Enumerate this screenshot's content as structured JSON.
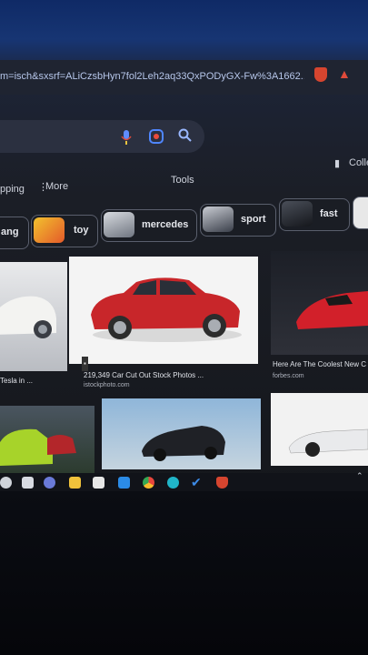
{
  "browser": {
    "url": "m=isch&sxsrf=ALiCzsbHyn7fol2Leh2aq33QxPODyGX-Fw%3A1662...",
    "collections_label": "Colle"
  },
  "tabs": {
    "shopping_label": "pping",
    "more_label": "More",
    "tools_label": "Tools"
  },
  "chips": [
    {
      "label": "ang"
    },
    {
      "label": "toy"
    },
    {
      "label": "mercedes"
    },
    {
      "label": "sport"
    },
    {
      "label": "fast"
    }
  ],
  "results": [
    {
      "caption": "Tesla in ...",
      "source": ""
    },
    {
      "caption": "219,349 Car Cut Out Stock Photos ...",
      "source": "istockphoto.com"
    },
    {
      "caption": "Here Are The Coolest New C",
      "source": "forbes.com"
    }
  ],
  "icons": [
    "mic-icon",
    "lens-icon",
    "search-icon",
    "brave-icon",
    "notification-icon",
    "collections-icon",
    "more-dots-icon",
    "image-badge-icon"
  ]
}
